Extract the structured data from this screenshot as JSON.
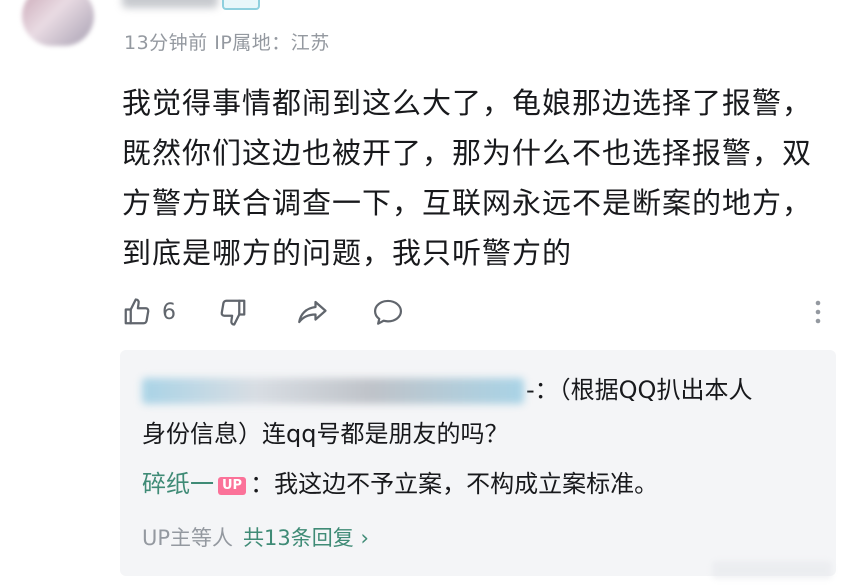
{
  "comment": {
    "meta": "13分钟前 IP属地：江苏",
    "text": "我觉得事情都闹到这么大了，龟娘那边选择了报警，既然你们这边也被开了，那为什么不也选择报警，双方警方联合调查一下，互联网永远不是断案的地方，到底是哪方的问题，我只听警方的",
    "like_count": "6"
  },
  "icons": {
    "like": "thumbs-up-icon",
    "dislike": "thumbs-down-icon",
    "share": "share-icon",
    "reply": "comment-bubble-icon",
    "more": "more-vertical-icon"
  },
  "replies": [
    {
      "suffix": "-：（根据QQ扒出本人",
      "line2": "身份信息）连qq号都是朋友的吗？"
    },
    {
      "user": "碎纸一",
      "badge": "UP",
      "text": "：我这边不予立案，不构成立案标准。"
    }
  ],
  "reply_footer": {
    "users": "UP主等人",
    "link": "共13条回复 ›"
  },
  "colors": {
    "accent_green": "#3f8b76",
    "up_badge": "#fb7299",
    "meta_gray": "#9499a0"
  }
}
